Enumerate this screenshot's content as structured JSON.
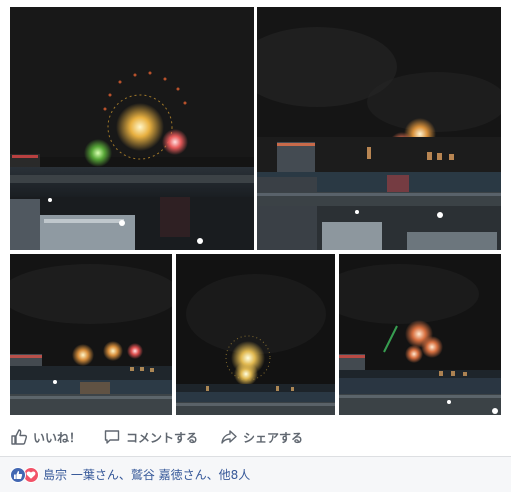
{
  "photos": [
    {
      "name": "fireworks-photo-1"
    },
    {
      "name": "fireworks-photo-2"
    },
    {
      "name": "fireworks-photo-3"
    },
    {
      "name": "fireworks-photo-4"
    },
    {
      "name": "fireworks-photo-5"
    }
  ],
  "actions": {
    "like_label": "いいね！",
    "comment_label": "コメントする",
    "share_label": "シェアする"
  },
  "reactions": {
    "icons": [
      "like-icon",
      "love-icon"
    ],
    "summary": "島宗 一葉さん、鷲谷 嘉徳さん、他8人"
  },
  "colors": {
    "accent": "#4267b2",
    "love": "#f25268",
    "link": "#365899",
    "action_text": "#606770",
    "footer_bg": "#f6f7f9"
  }
}
